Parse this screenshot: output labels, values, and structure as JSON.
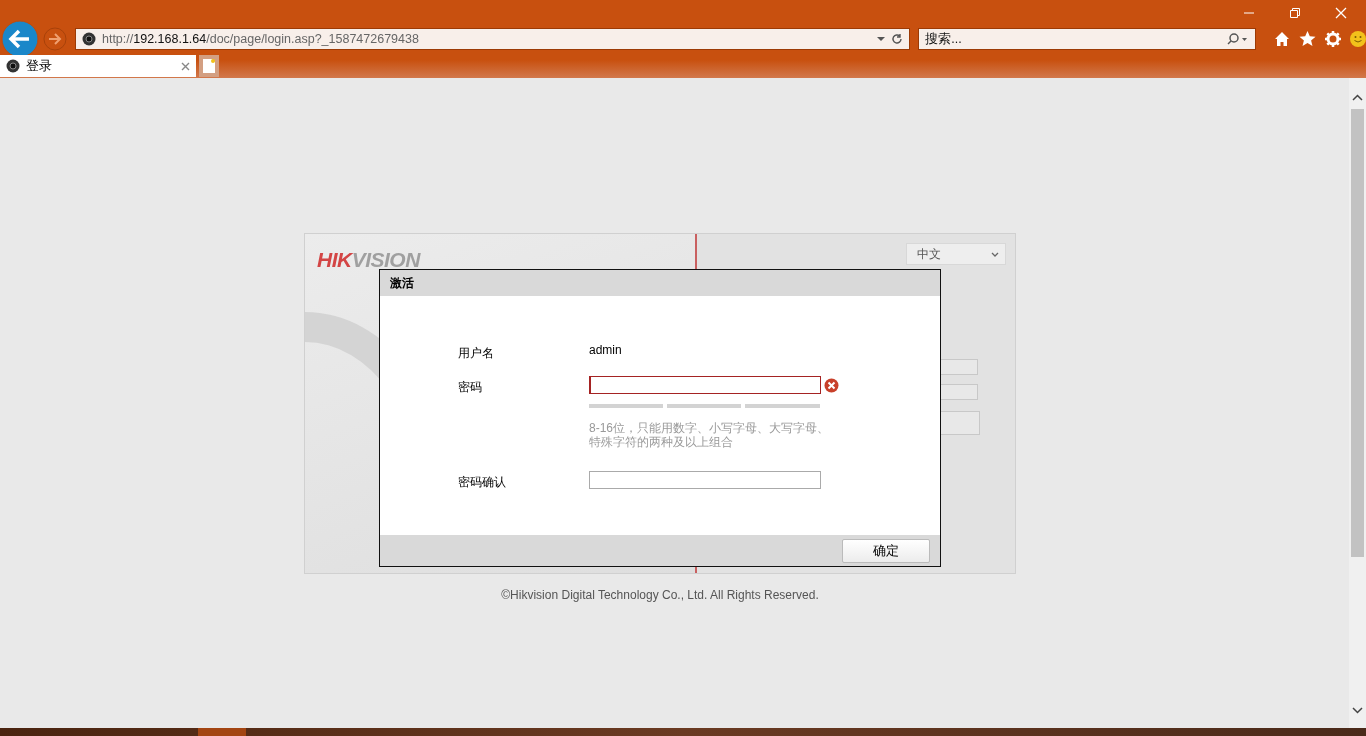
{
  "browser": {
    "address": {
      "host": "192.168.1.64",
      "prefix": "http://",
      "path": "/doc/page/login.asp?_1587472679438"
    },
    "search": {
      "placeholder": "搜索..."
    },
    "tabs": [
      {
        "label": "登录",
        "selected": true
      }
    ]
  },
  "login_panel": {
    "logo": {
      "part1": "HIK",
      "part2": "VISION"
    },
    "language": "中文"
  },
  "dialog": {
    "title": "激活",
    "fields": [
      {
        "kind": "text",
        "label": "用户名",
        "value": "admin"
      },
      {
        "kind": "password",
        "label": "密码",
        "error": true,
        "hint": "8-16位，只能用数字、小写字母、大写字母、特殊字符的两种及以上组合"
      },
      {
        "kind": "password",
        "label": "密码确认",
        "error": false
      }
    ],
    "buttons": [
      "确定"
    ]
  },
  "footer": "©Hikvision Digital Technology Co., Ltd. All Rights Reserved."
}
